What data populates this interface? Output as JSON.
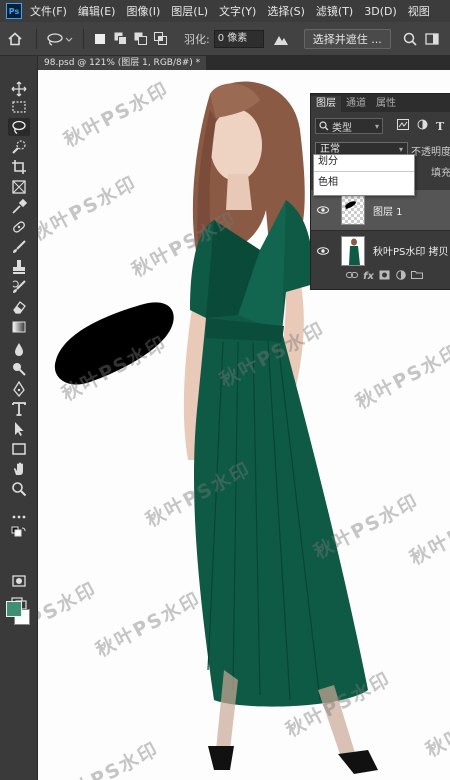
{
  "menu": {
    "logo": "Ps",
    "items": [
      "文件(F)",
      "编辑(E)",
      "图像(I)",
      "图层(L)",
      "文字(Y)",
      "选择(S)",
      "滤镜(T)",
      "3D(D)",
      "视图"
    ]
  },
  "options": {
    "feather_label": "羽化:",
    "feather_value": "0 像素",
    "select_mask_label": "选择并遮住 ..."
  },
  "document": {
    "tab_title": "98.psd @ 121% (图层 1, RGB/8#) *"
  },
  "watermark_text": "秋叶PS水印",
  "layers_panel": {
    "tabs": [
      "图层",
      "通道",
      "属性"
    ],
    "filter_label": "类型",
    "blend_mode": "正常",
    "opacity_label": "不透明度",
    "fill_label": "填充",
    "layers": [
      {
        "name": "图层 1",
        "selected": true
      },
      {
        "name": "秋叶PS水印 拷贝",
        "selected": false
      }
    ],
    "footer_fx": "fx"
  },
  "blend_dropdown": {
    "items": [
      "划分",
      "色相"
    ]
  },
  "colors": {
    "foreground": "#3f8f73",
    "background": "#ffffff",
    "dress": "#0e5a45"
  }
}
